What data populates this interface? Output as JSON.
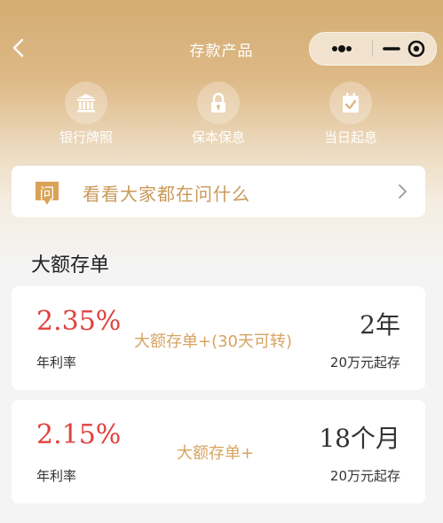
{
  "nav": {
    "title": "存款产品",
    "back_icon": "chevron-left-icon",
    "capsule": {
      "more_icon": "more-dots-icon",
      "minimize_icon": "minimize-icon",
      "close_icon": "target-close-icon"
    }
  },
  "features": [
    {
      "label": "银行牌照",
      "icon": "bank-icon"
    },
    {
      "label": "保本保息",
      "icon": "lock-icon"
    },
    {
      "label": "当日起息",
      "icon": "calendar-check-icon"
    }
  ],
  "ask": {
    "icon_char": "问",
    "text": "看看大家都在问什么",
    "arrow_icon": "chevron-right-icon"
  },
  "section": {
    "title": "大额存单"
  },
  "products": [
    {
      "rate": "2.35%",
      "rate_label": "年利率",
      "name": "大额存单+(30天可转)",
      "term": "2年",
      "min_amount": "20万元起存"
    },
    {
      "rate": "2.15%",
      "rate_label": "年利率",
      "name": "大额存单+",
      "term": "18个月",
      "min_amount": "20万元起存"
    }
  ],
  "colors": {
    "accent_gold": "#c9995a",
    "rate_red": "#e0423f",
    "header_gold": "#d3ad72"
  }
}
